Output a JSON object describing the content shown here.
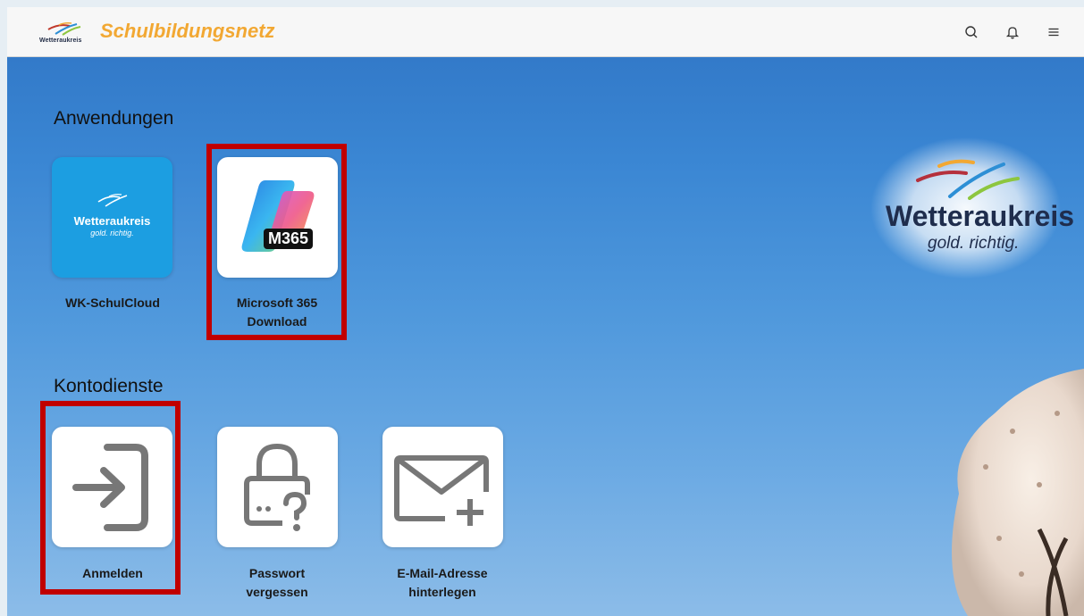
{
  "header": {
    "logo_text": "Wetteraukreis",
    "brand": "Schulbildungsnetz",
    "icons": [
      "search-icon",
      "bell-icon",
      "menu-icon"
    ]
  },
  "sections": {
    "apps": {
      "title": "Anwendungen",
      "items": [
        {
          "label": "WK-SchulCloud",
          "tile_logo": "Wetteraukreis",
          "tile_slogan": "gold. richtig."
        },
        {
          "label_line1": "Microsoft 365",
          "label_line2": "Download",
          "badge": "M365"
        }
      ]
    },
    "account": {
      "title": "Kontodienste",
      "items": [
        {
          "label": "Anmelden",
          "icon": "sign-in-icon"
        },
        {
          "label_line1": "Passwort",
          "label_line2": "vergessen",
          "icon": "lock-question-icon"
        },
        {
          "label_line1": "E-Mail-Adresse",
          "label_line2": "hinterlegen",
          "icon": "mail-add-icon"
        }
      ]
    }
  },
  "brand_logo": {
    "name": "Wetteraukreis",
    "slogan": "gold. richtig."
  },
  "colors": {
    "brand_orange": "#f2a833",
    "highlight_red": "#c00000",
    "tile_blue": "#1c9ee1",
    "logo_navy": "#1f2d4d"
  }
}
